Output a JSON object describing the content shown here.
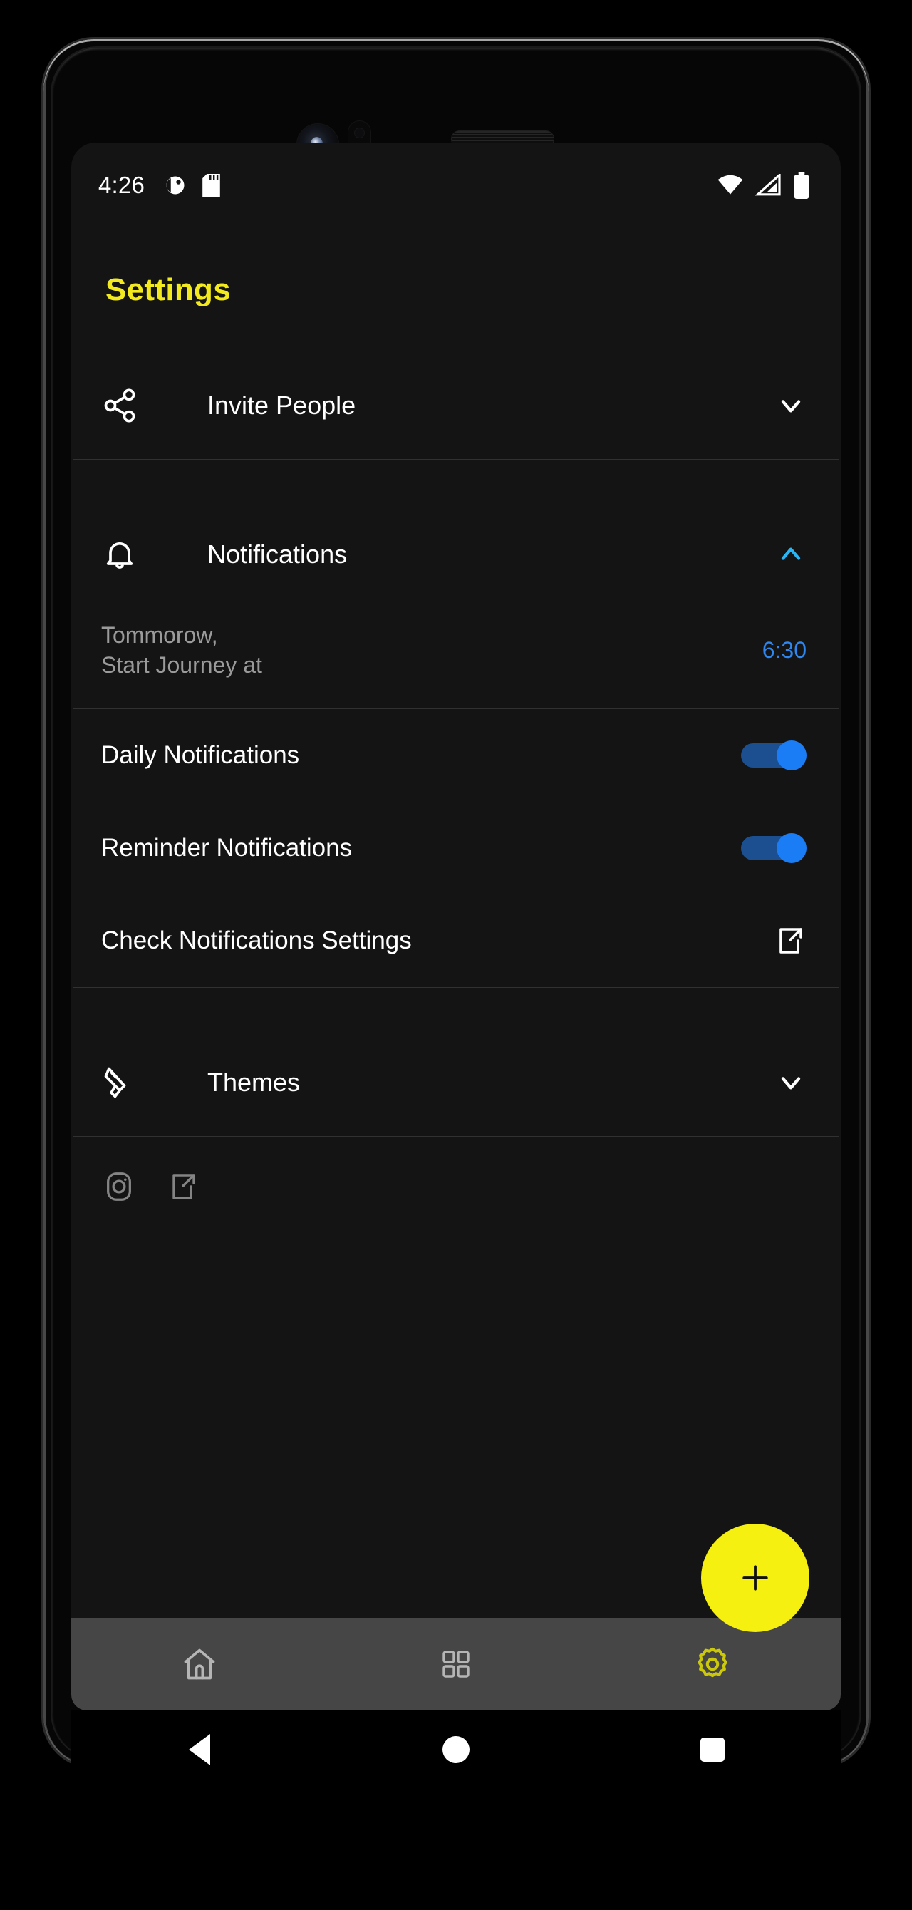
{
  "status_bar": {
    "time": "4:26",
    "left_icons": [
      "do-not-disturb-icon",
      "sd-card-icon"
    ],
    "right_icons": [
      "wifi-icon",
      "cellular-signal-icon",
      "battery-icon"
    ]
  },
  "header": {
    "title": "Settings",
    "title_color": "#f2ea1e"
  },
  "sections": {
    "invite": {
      "label": "Invite People",
      "icon": "share-icon",
      "chevron": "chevron-down-icon",
      "expanded": false
    },
    "notifications": {
      "label": "Notifications",
      "icon": "bell-icon",
      "chevron": "chevron-up-icon",
      "chevron_color": "#29b6f6",
      "expanded": true,
      "schedule": {
        "line1": "Tommorow,",
        "line2": "Start Journey at",
        "time": "6:30",
        "time_color": "#2e86f0"
      },
      "items": [
        {
          "label": "Daily Notifications",
          "control": "toggle",
          "value": "on"
        },
        {
          "label": "Reminder Notifications",
          "control": "toggle",
          "value": "on"
        },
        {
          "label": "Check Notifications Settings",
          "control": "external-link-icon"
        }
      ]
    },
    "themes": {
      "label": "Themes",
      "icon": "paint-brush-icon",
      "chevron": "chevron-down-icon",
      "expanded": false
    }
  },
  "social": {
    "items": [
      "instagram-icon",
      "external-link-icon"
    ]
  },
  "fab": {
    "label": "+",
    "color": "#f5f00f",
    "icon": "plus-icon"
  },
  "bottom_nav": {
    "items": [
      {
        "name": "home",
        "icon": "home-icon",
        "active": false
      },
      {
        "name": "dashboard",
        "icon": "grid-icon",
        "active": false
      },
      {
        "name": "settings",
        "icon": "gear-icon",
        "active": true
      }
    ],
    "active_color": "#cbc90a",
    "inactive_color": "#b5b5b5",
    "background": "#464646"
  },
  "system_nav": {
    "buttons": [
      "back-button",
      "home-button",
      "recents-button"
    ]
  }
}
